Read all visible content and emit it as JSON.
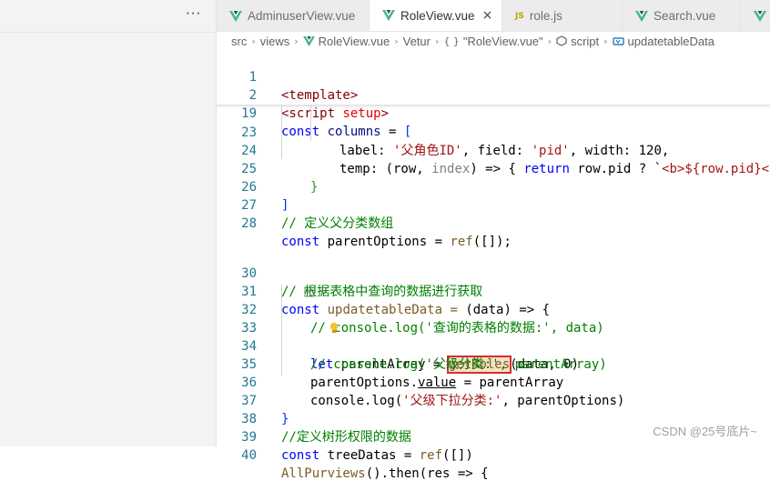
{
  "sidebar": {
    "more_label": "···"
  },
  "tabs": [
    {
      "label": "AdminuserView.vue",
      "icon": "vue-icon",
      "active": false
    },
    {
      "label": "RoleView.vue",
      "icon": "vue-icon",
      "active": true,
      "close": "×"
    },
    {
      "label": "role.js",
      "icon": "js-icon",
      "icon_text": "JS",
      "active": false
    },
    {
      "label": "Search.vue",
      "icon": "vue-icon",
      "active": false
    }
  ],
  "breadcrumb": {
    "items": [
      "src",
      "views",
      "RoleView.vue",
      "Vetur",
      "\"RoleView.vue\"",
      "script",
      "updatetableData"
    ],
    "braces": "{ }"
  },
  "editor": {
    "line_numbers": [
      "1",
      "2",
      "19",
      "23",
      "24",
      "25",
      "26",
      "27",
      "28",
      "",
      "30",
      "31",
      "32",
      "33",
      "34",
      "35",
      "36",
      "37",
      "38",
      "39",
      "40"
    ],
    "tokens": {
      "template_tag": "<template>",
      "script_open": "<script",
      "setup_attr": "setup",
      "script_close": ">",
      "const": "const",
      "columns": "columns",
      "eq": " = ",
      "open_bracket": "[",
      "label_key": "label: ",
      "label_val": "'父角色ID'",
      "field_key": ", field: ",
      "field_val": "'pid'",
      "width_part": ", width: 120,",
      "temp_key": "temp: ",
      "temp_params": "(row, ",
      "index_param": "index",
      "temp_arrow": ") => { ",
      "return_kw": "return",
      "return_expr": " row.pid ? `",
      "tmpl_b": "<b>${row.pid}</b>",
      "close_brace": "}",
      "close_bracket": "]",
      "comment_27": "// 定义父分类数组",
      "parentOptions": " parentOptions = ",
      "ref_call": "ref",
      "ref_args": "([]);",
      "comment_30": "// 根据表格中查询的数据进行获取",
      "updatetableData": " updatetableData = ",
      "data_param": "(data) => {",
      "comment_32": "// console.log('查询的表格的数据:', data)",
      "let_kw": "let",
      "parentArray": " parentArray = ",
      "getRoles": "getRoles",
      "getRoles_args": "(data, 0)",
      "comment_34": "// console.log('父级分类:', parentArray)",
      "line35_a": "parentOptions.",
      "line35_value": "value",
      "line35_b": " = parentArray",
      "line36_a": "console.log(",
      "line36_str": "'父级下拉分类:'",
      "line36_b": ", parentOptions)",
      "close_brace_37": "}",
      "comment_38": "//定义树形权限的数据",
      "treeDatas": " treeDatas = ",
      "ref_args_39": "([])",
      "allPurviews": "AllPurviews",
      "line40_b": "().then(res => {"
    }
  },
  "watermark": "CSDN @25号底片~"
}
